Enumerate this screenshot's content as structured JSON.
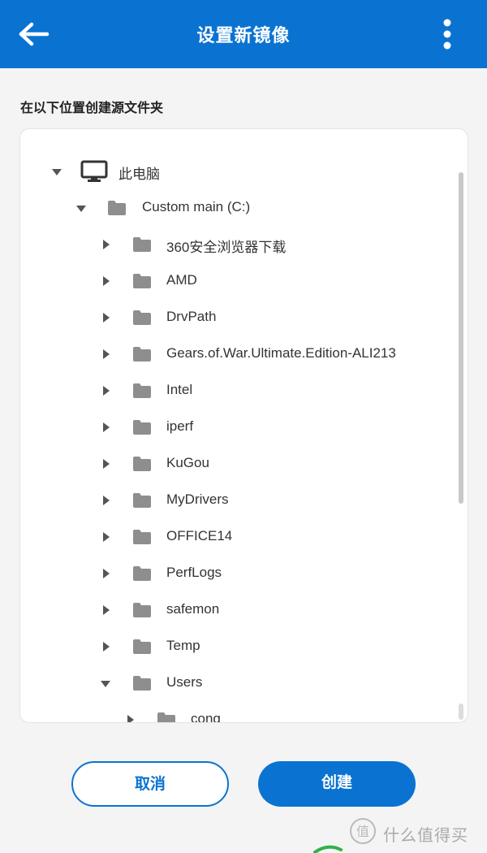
{
  "header": {
    "title": "设置新镜像",
    "back_icon": "arrow-left-icon",
    "menu_icon": "more-vertical-icon",
    "color": "#0a73d2"
  },
  "section_label": "在以下位置创建源文件夹",
  "tree": {
    "root": {
      "label": "此电脑",
      "icon": "computer-icon",
      "expanded": true
    },
    "drive": {
      "label": "Custom main (C:)",
      "icon": "folder-icon",
      "expanded": true
    },
    "folders": [
      {
        "label": "360安全浏览器下载",
        "expanded": false
      },
      {
        "label": "AMD",
        "expanded": false
      },
      {
        "label": "DrvPath",
        "expanded": false
      },
      {
        "label": "Gears.of.War.Ultimate.Edition-ALI213",
        "expanded": false
      },
      {
        "label": "Intel",
        "expanded": false
      },
      {
        "label": "iperf",
        "expanded": false
      },
      {
        "label": "KuGou",
        "expanded": false
      },
      {
        "label": "MyDrivers",
        "expanded": false
      },
      {
        "label": "OFFICE14",
        "expanded": false
      },
      {
        "label": "PerfLogs",
        "expanded": false
      },
      {
        "label": "safemon",
        "expanded": false
      },
      {
        "label": "Temp",
        "expanded": false
      },
      {
        "label": "Users",
        "expanded": true
      }
    ],
    "subfolders": [
      {
        "label": "cong",
        "expanded": false
      }
    ]
  },
  "actions": {
    "cancel_label": "取消",
    "create_label": "创建"
  },
  "watermark": {
    "text": "什么值得买",
    "icon": "值"
  }
}
